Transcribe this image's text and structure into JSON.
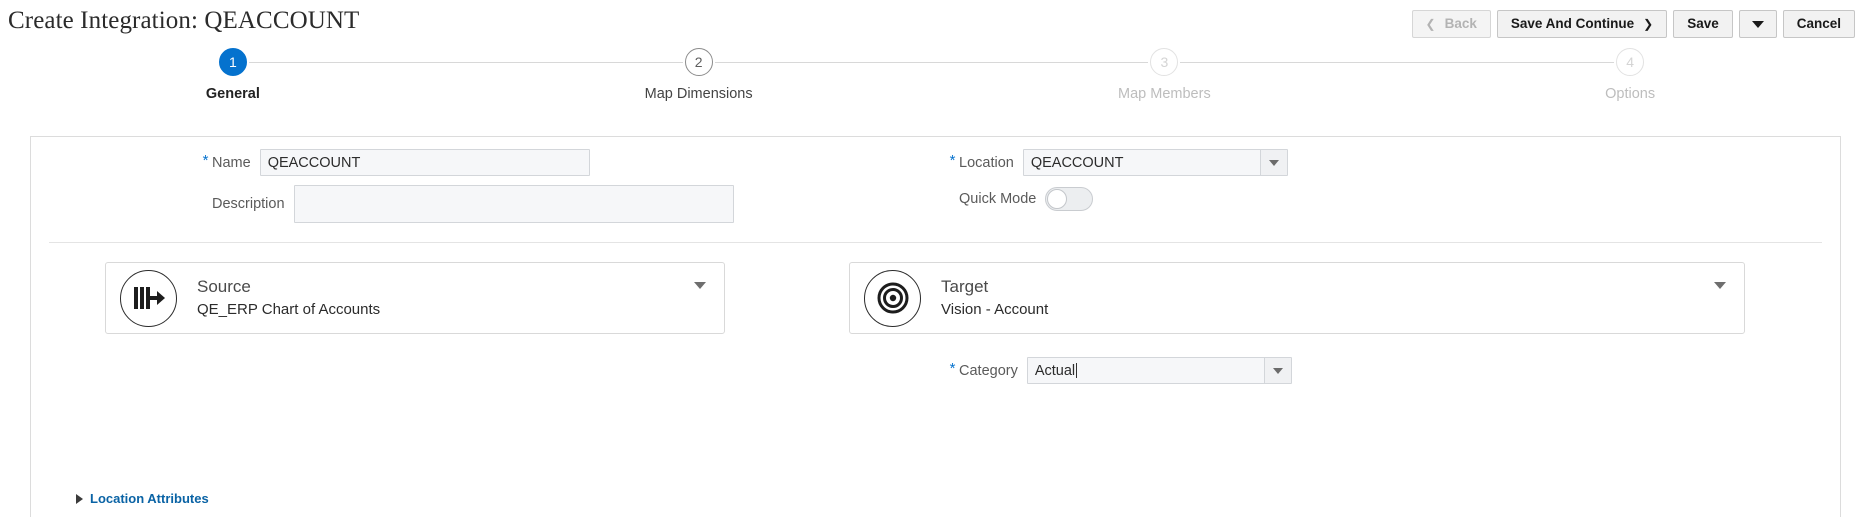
{
  "header": {
    "title": "Create Integration: QEACCOUNT",
    "buttons": [
      {
        "label": "Back",
        "icon": "chevron-left-icon",
        "disabled": true
      },
      {
        "label": "Save And Continue",
        "icon": "chevron-right-icon",
        "disabled": false
      },
      {
        "label": "Save",
        "icon": "",
        "disabled": false
      },
      {
        "label": "",
        "icon": "caret-down-icon",
        "disabled": false
      },
      {
        "label": "Cancel",
        "icon": "",
        "disabled": false
      }
    ]
  },
  "stepper": {
    "steps": [
      {
        "number": "1",
        "label": "General",
        "state": "active"
      },
      {
        "number": "2",
        "label": "Map Dimensions",
        "state": "todo"
      },
      {
        "number": "3",
        "label": "Map Members",
        "state": "disabled"
      },
      {
        "number": "4",
        "label": "Options",
        "state": "disabled"
      }
    ]
  },
  "form": {
    "name": {
      "label": "Name",
      "value": "QEACCOUNT",
      "required": true,
      "placeholder": ""
    },
    "description": {
      "label": "Description",
      "value": "",
      "required": false,
      "placeholder": ""
    },
    "location": {
      "label": "Location",
      "value": "QEACCOUNT",
      "required": true
    },
    "quick_mode": {
      "label": "Quick Mode",
      "value": "off"
    }
  },
  "source_card": {
    "kind": "Source",
    "value": "QE_ERP Chart of Accounts",
    "icon": "source-flow-icon"
  },
  "target_card": {
    "kind": "Target",
    "value": "Vision - Account",
    "icon": "target-bullseye-icon"
  },
  "category": {
    "label": "Category",
    "value": "Actual",
    "required": true
  },
  "location_attributes": {
    "label": "Location Attributes",
    "expanded": false
  },
  "colors": {
    "accent": "#0572ce",
    "link": "#0a63a5",
    "field_bg": "#f6f7f9",
    "border": "#d9d9d9"
  }
}
